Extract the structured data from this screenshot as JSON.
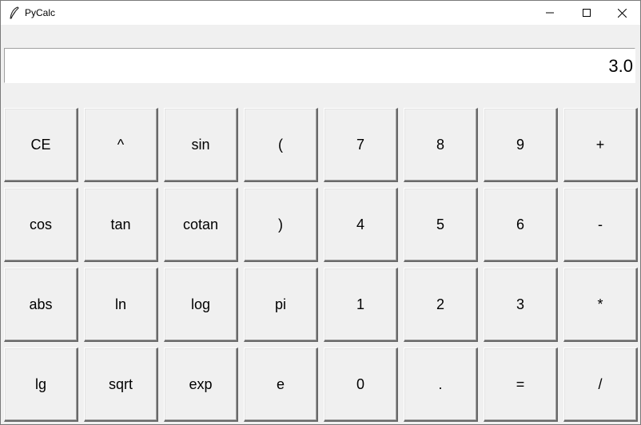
{
  "window": {
    "title": "PyCalc",
    "icon": "feather-icon",
    "controls": [
      "minimize-icon",
      "maximize-icon",
      "close-icon"
    ]
  },
  "display": {
    "value": "3.0"
  },
  "keypad": {
    "rows": [
      [
        "CE",
        "^",
        "sin",
        "(",
        "7",
        "8",
        "9",
        "+"
      ],
      [
        "cos",
        "tan",
        "cotan",
        ")",
        "4",
        "5",
        "6",
        "-"
      ],
      [
        "abs",
        "ln",
        "log",
        "pi",
        "1",
        "2",
        "3",
        "*"
      ],
      [
        "lg",
        "sqrt",
        "exp",
        "e",
        "0",
        ".",
        "=",
        "/"
      ]
    ]
  }
}
